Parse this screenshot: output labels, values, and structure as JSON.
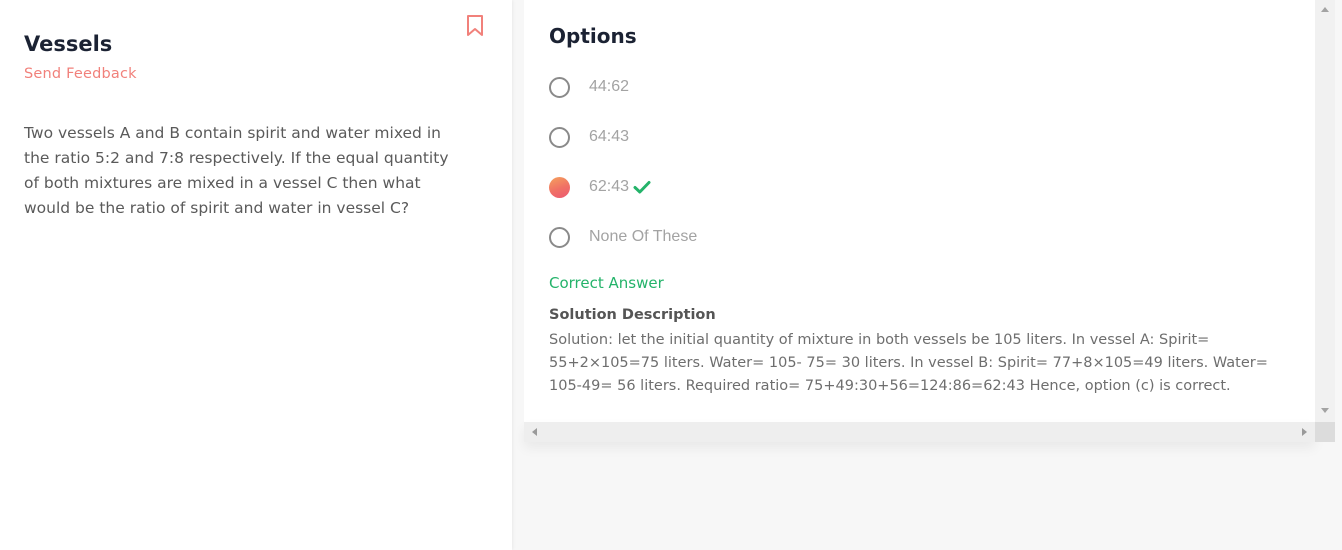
{
  "question": {
    "title": "Vessels",
    "feedback_label": "Send Feedback",
    "bookmark_icon": "bookmark-icon",
    "text": "Two vessels A and B contain spirit and water mixed in the ratio 5:2 and 7:8 respectively. If the equal quantity of both mixtures are mixed in a vessel C then what would be the ratio of spirit and water in vessel C?"
  },
  "options": {
    "title": "Options",
    "items": [
      {
        "label": "44:62",
        "selected": false
      },
      {
        "label": "64:43",
        "selected": false
      },
      {
        "label": "62:43",
        "selected": true,
        "correct": true
      },
      {
        "label": "None Of These",
        "selected": false
      }
    ],
    "correct_label": "Correct Answer",
    "solution_title": "Solution Description",
    "solution_text": "Solution: let the initial quantity of mixture in both vessels be 105 liters. In vessel A: Spirit= 55+2×105=75 liters. Water= 105- 75= 30 liters. In vessel B: Spirit= 77+8×105=49 liters. Water= 105-49= 56 liters. Required ratio= 75+49:30+56=124:86=62:43 Hence, option (c) is correct."
  },
  "colors": {
    "accent": "#f1817b",
    "correct": "#24b36a",
    "heading": "#1b2233"
  }
}
